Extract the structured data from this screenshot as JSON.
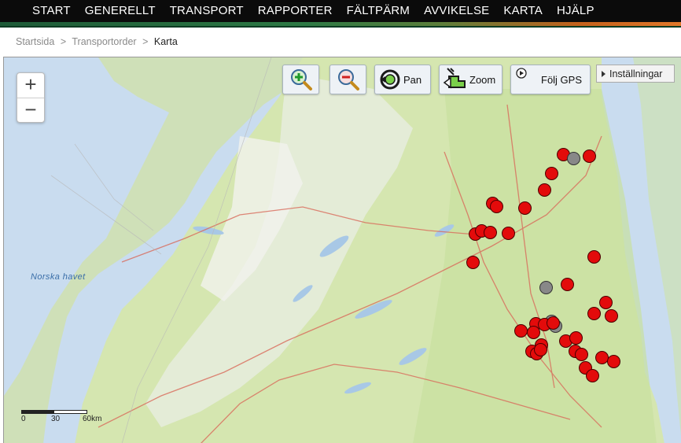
{
  "nav": {
    "items": [
      "START",
      "GENERELLT",
      "TRANSPORT",
      "RAPPORTER",
      "FÄLTPÄRM",
      "AVVIKELSE",
      "KARTA",
      "HJÄLP"
    ]
  },
  "breadcrumb": {
    "items": [
      "Startsida",
      ">",
      "Transportorder",
      ">"
    ],
    "current": "Karta"
  },
  "zoom": {
    "in": "+",
    "out": "−"
  },
  "toolbar": {
    "pan": "Pan",
    "zoom": "Zoom",
    "follow_gps": "Följ GPS"
  },
  "settings": {
    "label": "Inställningar"
  },
  "map": {
    "sea_label": "Norska havet",
    "scale": {
      "zero": "0",
      "mid": "30",
      "max": "60km"
    },
    "colors": {
      "marker_red": "#e30b0b",
      "marker_grey": "#888888",
      "land": "#d7e6b5",
      "sea": "#c9dcef"
    }
  }
}
